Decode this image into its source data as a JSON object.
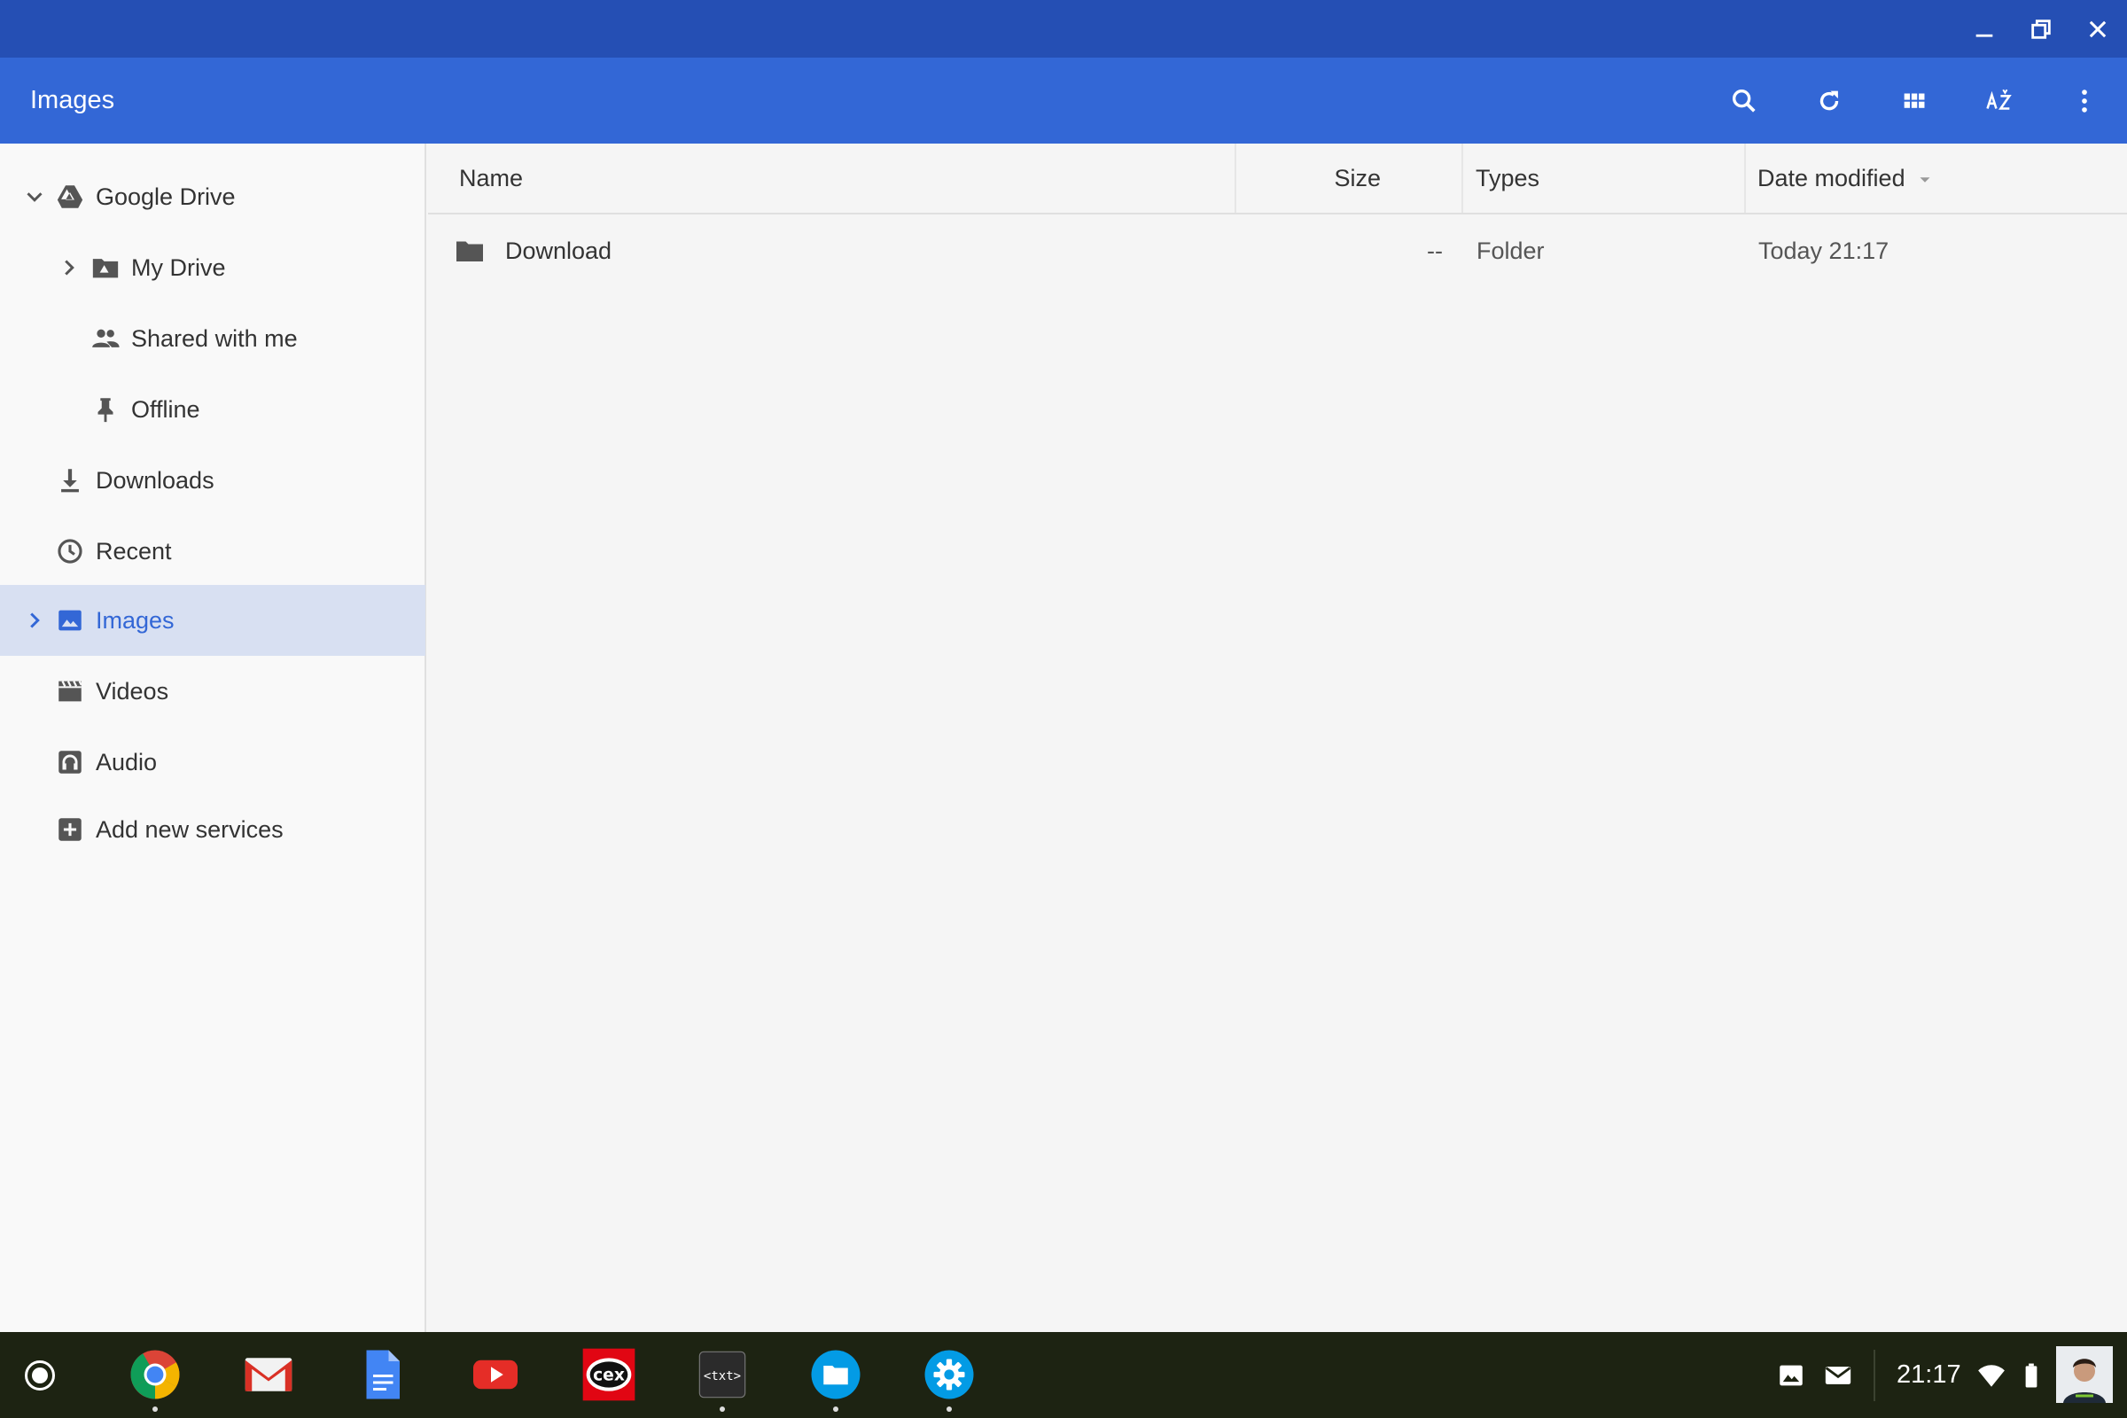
{
  "toolbar": {
    "title": "Images"
  },
  "sidebar": {
    "items": [
      {
        "label": "Google Drive"
      },
      {
        "label": "My Drive"
      },
      {
        "label": "Shared with me"
      },
      {
        "label": "Offline"
      },
      {
        "label": "Downloads"
      },
      {
        "label": "Recent"
      },
      {
        "label": "Images"
      },
      {
        "label": "Videos"
      },
      {
        "label": "Audio"
      },
      {
        "label": "Add new services"
      }
    ],
    "selected": "Images"
  },
  "table": {
    "columns": [
      "Name",
      "Size",
      "Types",
      "Date modified"
    ],
    "sort": {
      "column": "Date modified",
      "direction": "descending"
    },
    "rows": [
      {
        "name": "Download",
        "size": "--",
        "type": "Folder",
        "modified": "Today 21:17"
      }
    ]
  },
  "shelf": {
    "apps": [
      "chrome",
      "gmail",
      "docs",
      "youtube",
      "cex",
      "text",
      "files",
      "settings"
    ],
    "time": "21:17"
  },
  "colors": {
    "titlebar": "#254fb4",
    "toolbar": "#3367d6",
    "selected_bg": "#d8e0f2",
    "accent": "#3367d6",
    "shelf": "#1d2312"
  }
}
